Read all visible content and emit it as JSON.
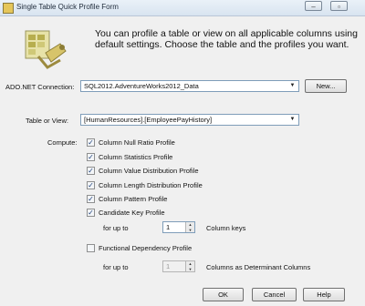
{
  "window": {
    "title": "Single Table Quick Profile Form"
  },
  "intro": {
    "text": "You can profile a table or view on all applicable columns using default settings. Choose the table and the profiles you want."
  },
  "connection": {
    "label": "ADO.NET Connection:",
    "value": "SQL2012.AdventureWorks2012_Data",
    "new_label": "New..."
  },
  "table": {
    "label": "Table or View:",
    "value": "[HumanResources].[EmployeePayHistory]"
  },
  "compute": {
    "label": "Compute:",
    "profiles": [
      {
        "label": "Column Null Ratio Profile",
        "checked": true
      },
      {
        "label": "Column Statistics Profile",
        "checked": true
      },
      {
        "label": "Column Value Distribution Profile",
        "checked": true
      },
      {
        "label": "Column Length Distribution Profile",
        "checked": true
      },
      {
        "label": "Column Pattern Profile",
        "checked": true
      },
      {
        "label": "Candidate Key Profile",
        "checked": true
      }
    ]
  },
  "candidate_key": {
    "for_up_to_label": "for up to",
    "value": "1",
    "suffix": "Column keys"
  },
  "functional_dependency": {
    "label": "Functional Dependency Profile",
    "checked": false,
    "for_up_to_label": "for up to",
    "value": "1",
    "suffix": "Columns as Determinant Columns"
  },
  "buttons": {
    "ok": "OK",
    "cancel": "Cancel",
    "help": "Help"
  }
}
